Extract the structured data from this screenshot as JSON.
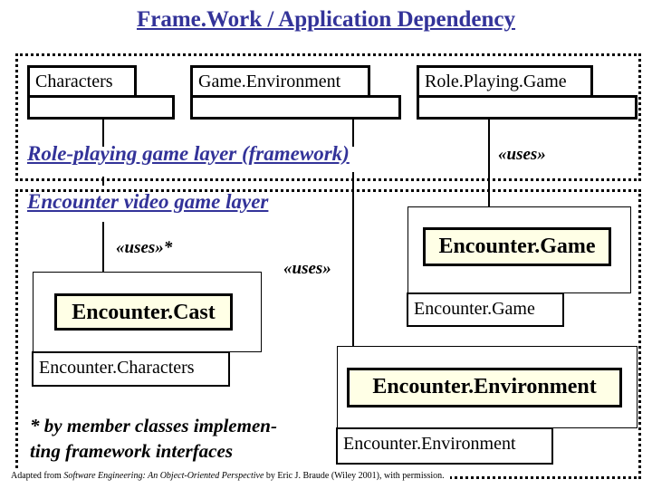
{
  "title": "Frame.Work / Application Dependency",
  "framework_layer": {
    "label": "Role-playing game layer (framework)",
    "classes": [
      {
        "name": "Characters"
      },
      {
        "name": "Game.Environment"
      },
      {
        "name": "Role.Playing.Game"
      }
    ],
    "uses_label": "«uses»"
  },
  "application_layer": {
    "label": "Encounter video game layer",
    "uses_star_label": "«uses»*",
    "uses_label": "«uses»",
    "packages": [
      {
        "name": "Encounter.Game",
        "tab": "Encounter.Game"
      },
      {
        "name": "Encounter.Cast",
        "tab": "Encounter.Characters"
      },
      {
        "name": "Encounter.Environment",
        "tab": "Encounter.Environment"
      }
    ]
  },
  "footnote": "* by member classes implemen-ting framework interfaces",
  "footnote_lines": [
    "* by member classes implemen-",
    "ting framework interfaces"
  ],
  "credit": {
    "prefix": "Adapted from ",
    "book": "Software Engineering: An Object-Oriented Perspective",
    "suffix": " by Eric J. Braude (Wiley 2001), with permission."
  },
  "colors": {
    "heading": "#333399",
    "package_fill": "#ffffe6"
  }
}
